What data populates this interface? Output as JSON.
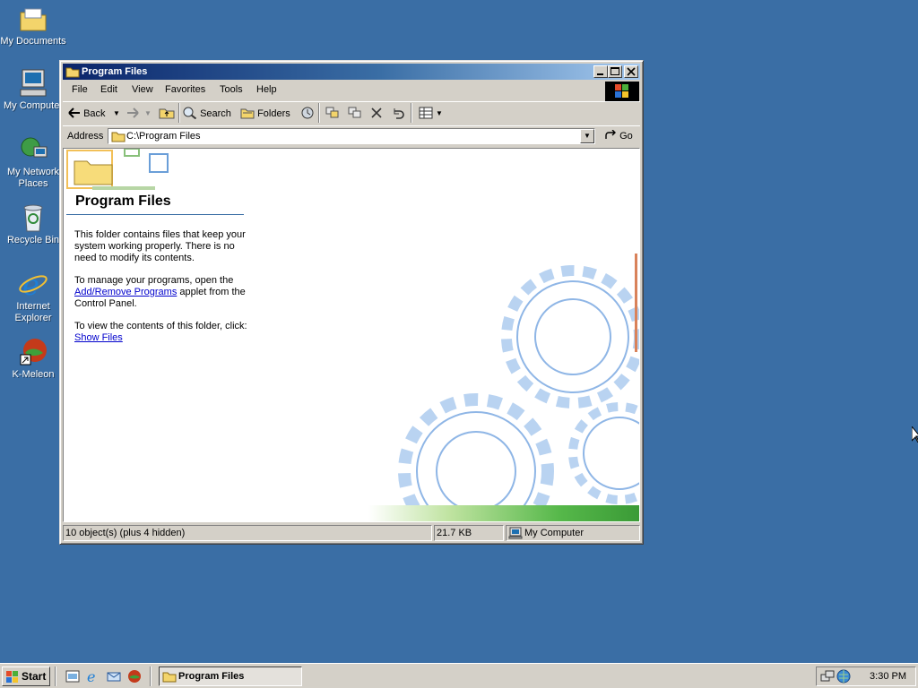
{
  "desktop": {
    "icons": [
      {
        "label": "My Documents"
      },
      {
        "label": "My Computer"
      },
      {
        "label": "My Network Places"
      },
      {
        "label": "Recycle Bin"
      },
      {
        "label": "Internet Explorer"
      },
      {
        "label": "K-Meleon"
      }
    ]
  },
  "window": {
    "title": "Program Files",
    "menu": [
      "File",
      "Edit",
      "View",
      "Favorites",
      "Tools",
      "Help"
    ],
    "toolbar": {
      "back": "Back",
      "search": "Search",
      "folders": "Folders"
    },
    "address": {
      "label": "Address",
      "value": "C:\\Program Files",
      "go": "Go"
    },
    "content": {
      "heading": "Program Files",
      "para1": "This folder contains files that keep your system working properly. There is no need to modify its contents.",
      "para2_before": "To manage your programs, open the ",
      "para2_link": "Add/Remove Programs",
      "para2_after": " applet from the Control Panel.",
      "para3_before": "To view the contents of this folder, click: ",
      "para3_link": "Show Files"
    },
    "status": {
      "objects": "10 object(s) (plus 4 hidden)",
      "size": "21.7 KB",
      "location": "My Computer"
    }
  },
  "taskbar": {
    "start": "Start",
    "task": "Program Files",
    "clock": "3:30 PM"
  },
  "colors": {
    "desktop": "#3a6ea5",
    "title_start": "#0a246a",
    "title_end": "#a6caf0",
    "face": "#d4d0c8"
  }
}
